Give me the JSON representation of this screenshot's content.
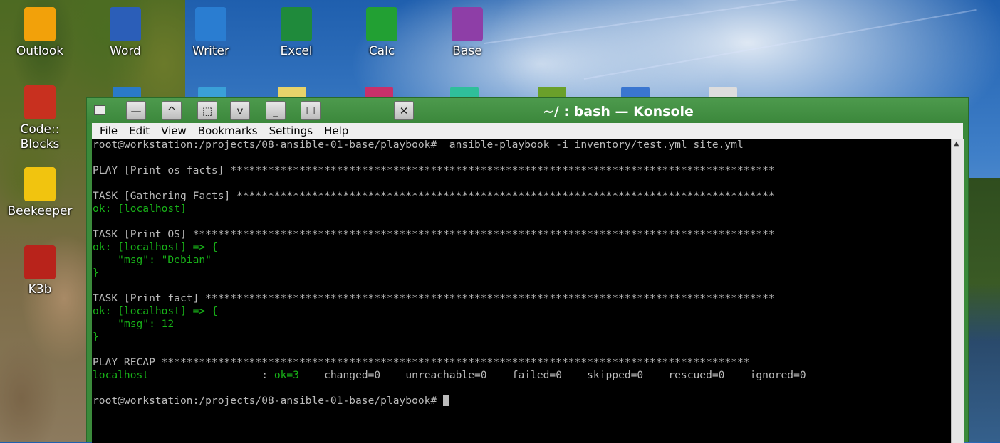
{
  "desktop": {
    "icons": [
      {
        "label": "Outlook",
        "color": "#f2a10a"
      },
      {
        "label": "Word",
        "color": "#2b5eb8"
      },
      {
        "label": "Writer",
        "color": "#2a7dd1"
      },
      {
        "label": "Excel",
        "color": "#1f8a3b"
      },
      {
        "label": "Calc",
        "color": "#22a033"
      },
      {
        "label": "Base",
        "color": "#8e3ea7"
      },
      {
        "label": "Code::\nBlocks",
        "color": "#c8301f"
      },
      {
        "label": "Beekeeper",
        "color": "#f1c40f"
      },
      {
        "label": "K3b",
        "color": "#b8231b"
      }
    ]
  },
  "window": {
    "title": "~/ : bash — Konsole",
    "accent": "#3b8a3b",
    "buttons": [
      "—",
      "^",
      "⬚",
      "v",
      "_",
      "☐",
      "✕"
    ]
  },
  "menubar": {
    "items": [
      "File",
      "Edit",
      "View",
      "Bookmarks",
      "Settings",
      "Help"
    ]
  },
  "terminal": {
    "text_color": "#bbbbbb",
    "ok_color": "#18b218",
    "lines": [
      {
        "text": "root@workstation:/projects/08-ansible-01-base/playbook#  ansible-playbook -i inventory/test.yml site.yml",
        "style": "normal"
      },
      {
        "text": "",
        "style": "normal"
      },
      {
        "text": "PLAY [Print os facts] ***************************************************************************************",
        "style": "normal"
      },
      {
        "text": "",
        "style": "normal"
      },
      {
        "text": "TASK [Gathering Facts] **************************************************************************************",
        "style": "normal"
      },
      {
        "text": "ok: [localhost]",
        "style": "ok"
      },
      {
        "text": "",
        "style": "normal"
      },
      {
        "text": "TASK [Print OS] *********************************************************************************************",
        "style": "normal"
      },
      {
        "text": "ok: [localhost] => {",
        "style": "ok"
      },
      {
        "text": "    \"msg\": \"Debian\"",
        "style": "ok"
      },
      {
        "text": "}",
        "style": "ok"
      },
      {
        "text": "",
        "style": "normal"
      },
      {
        "text": "TASK [Print fact] *******************************************************************************************",
        "style": "normal"
      },
      {
        "text": "ok: [localhost] => {",
        "style": "ok"
      },
      {
        "text": "    \"msg\": 12",
        "style": "ok"
      },
      {
        "text": "}",
        "style": "ok"
      },
      {
        "text": "",
        "style": "normal"
      },
      {
        "text": "PLAY RECAP **********************************************************************************************",
        "style": "normal"
      },
      {
        "text": "",
        "style": "recap"
      },
      {
        "text": "",
        "style": "normal"
      },
      {
        "text": "root@workstation:/projects/08-ansible-01-base/playbook# ",
        "style": "prompt"
      }
    ],
    "recap": {
      "host": "localhost",
      "sep": "                  : ",
      "ok": "ok=3",
      "rest": "    changed=0    unreachable=0    failed=0    skipped=0    rescued=0    ignored=0"
    }
  }
}
